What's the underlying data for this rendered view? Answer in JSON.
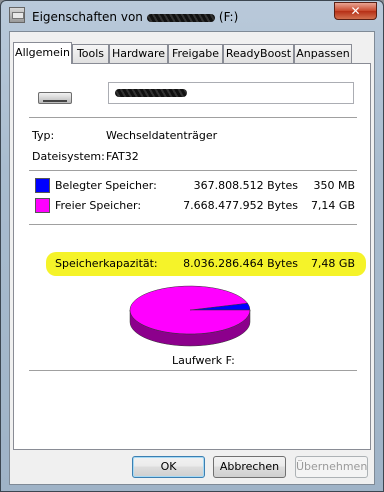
{
  "window": {
    "title_prefix": "Eigenschaften von",
    "title_drive": "(F:)",
    "close_label": "✕"
  },
  "tabs": [
    {
      "label": "Allgemein"
    },
    {
      "label": "Tools"
    },
    {
      "label": "Hardware"
    },
    {
      "label": "Freigabe"
    },
    {
      "label": "ReadyBoost"
    },
    {
      "label": "Anpassen"
    }
  ],
  "general": {
    "type_label": "Typ:",
    "type_value": "Wechseldatenträger",
    "fs_label": "Dateisystem:",
    "fs_value": "FAT32"
  },
  "used": {
    "label": "Belegter Speicher:",
    "bytes": "367.808.512 Bytes",
    "size": "350 MB",
    "color": "#0000ff"
  },
  "free": {
    "label": "Freier Speicher:",
    "bytes": "7.668.477.952 Bytes",
    "size": "7,14 GB",
    "color": "#ff00ff"
  },
  "capacity": {
    "label": "Speicherkapazität:",
    "bytes": "8.036.286.464 Bytes",
    "size": "7,48 GB",
    "highlight_color": "#f4f21e"
  },
  "chart_data": {
    "type": "pie",
    "slices": [
      {
        "label": "Belegter Speicher",
        "value": 367808512,
        "color": "#0000ff"
      },
      {
        "label": "Freier Speicher",
        "value": 7668477952,
        "color": "#ff00ff"
      }
    ],
    "caption": "Laufwerk F:"
  },
  "buttons": {
    "ok": "OK",
    "cancel": "Abbrechen",
    "apply": "Übernehmen"
  }
}
